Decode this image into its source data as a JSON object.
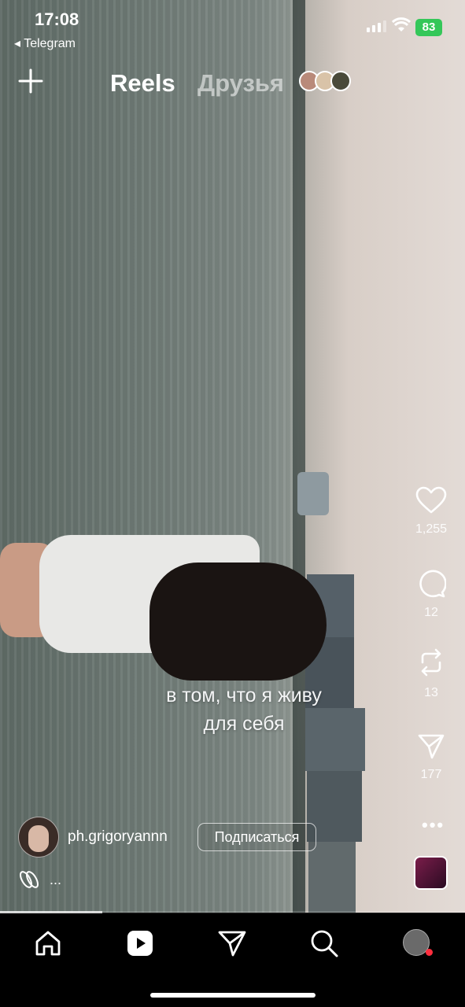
{
  "status_bar": {
    "time": "17:08",
    "back_app": "◂ Telegram",
    "battery": "83"
  },
  "top_nav": {
    "tabs": [
      {
        "label": "Reels",
        "active": true
      },
      {
        "label": "Друзья",
        "active": false
      }
    ]
  },
  "reel": {
    "caption_line1": "в том, что я живу",
    "caption_line2": "для себя",
    "author": "ph.grigoryannn",
    "follow_label": "Подписаться",
    "collab_text": "...",
    "progress_fraction": 0.22
  },
  "actions": {
    "likes": "1,255",
    "comments": "12",
    "reposts": "13",
    "shares": "177",
    "more": "•••"
  },
  "bottom_nav": {
    "items": [
      "home-icon",
      "reels-icon",
      "send-icon",
      "search-icon",
      "profile-avatar"
    ],
    "notification_color": "#ff2d3d"
  }
}
